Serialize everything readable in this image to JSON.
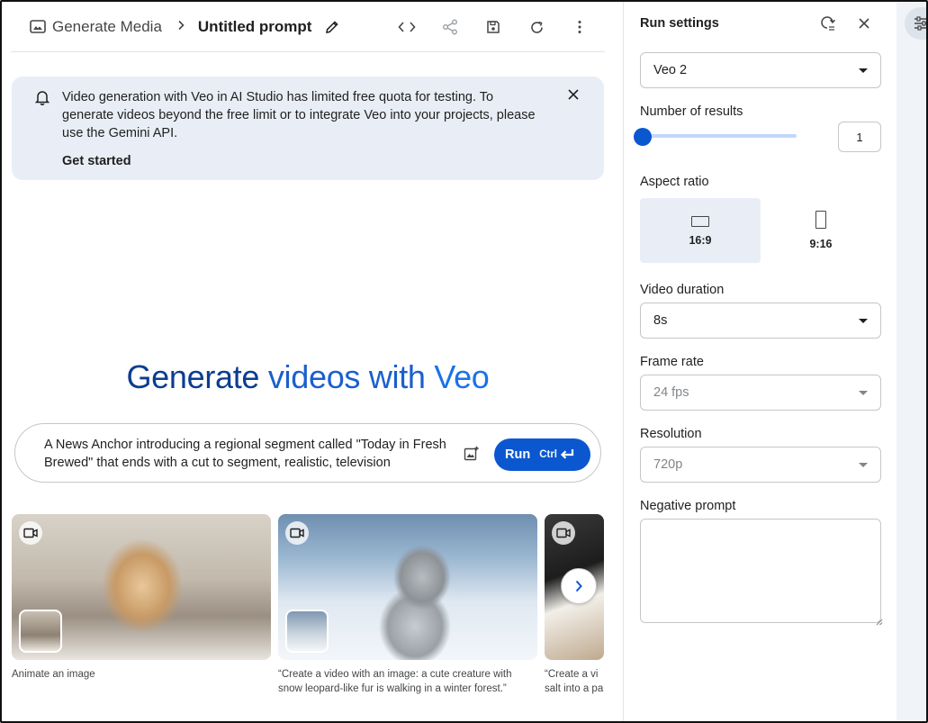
{
  "header": {
    "parent": "Generate Media",
    "title": "Untitled prompt"
  },
  "banner": {
    "message": "Video generation with Veo in AI Studio has limited free quota for testing. To generate videos beyond the free limit or to integrate Veo into your projects, please use the Gemini API.",
    "cta": "Get started"
  },
  "hero": {
    "part1": "Generate ",
    "part2": "videos with ",
    "part3": "Veo"
  },
  "prompt": {
    "value": "A News Anchor introducing a regional segment called \"Today in Fresh Brewed\" that ends with a cut to segment, realistic, television",
    "run_label": "Run",
    "shortcut": "Ctrl"
  },
  "examples": [
    {
      "caption": "Animate an image"
    },
    {
      "caption": "“Create a video with an image: a cute creature with snow leopard-like fur is walking in a winter forest.”"
    },
    {
      "caption": "“Create a vi salt into a pa"
    }
  ],
  "settings": {
    "title": "Run settings",
    "model": "Veo 2",
    "results_label": "Number of results",
    "results_value": "1",
    "results_level": 0,
    "aspect_label": "Aspect ratio",
    "aspect_options": [
      "16:9",
      "9:16"
    ],
    "aspect_selected": "16:9",
    "duration_label": "Video duration",
    "duration": "8s",
    "framerate_label": "Frame rate",
    "framerate": "24 fps",
    "resolution_label": "Resolution",
    "resolution": "720p",
    "negative_label": "Negative prompt",
    "negative_value": ""
  },
  "colors": {
    "primary": "#0b57d0",
    "banner_bg": "#e9eef6",
    "hero_dark": "#0b3d91",
    "hero_light": "#1a73e8"
  }
}
